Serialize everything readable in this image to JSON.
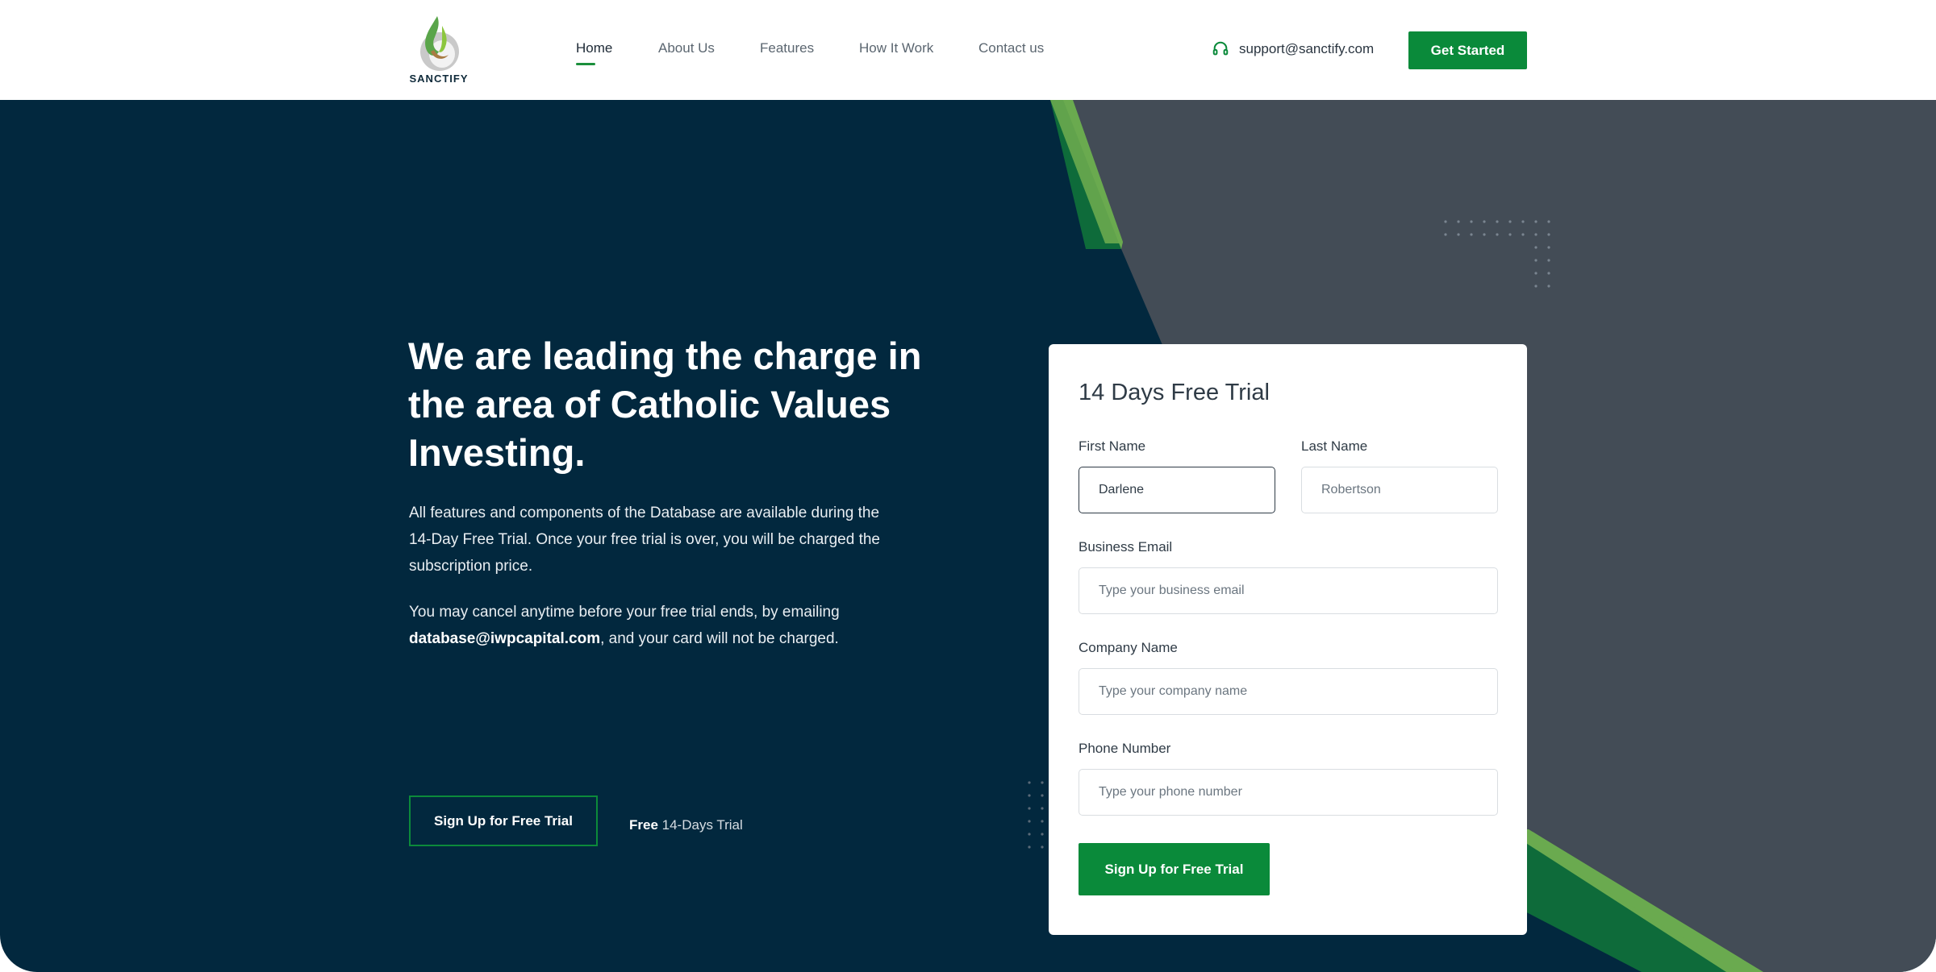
{
  "header": {
    "logo_text": "SANCTIFY",
    "nav": [
      {
        "label": "Home",
        "active": true
      },
      {
        "label": "About Us"
      },
      {
        "label": "Features"
      },
      {
        "label": "How It Work"
      },
      {
        "label": "Contact us"
      }
    ],
    "support_email": "support@sanctify.com",
    "support_icon": "headset-icon",
    "cta_label": "Get Started"
  },
  "hero": {
    "headline": "We are leading the charge in the area of Catholic Values Investing.",
    "paragraph1": "All features and components of the Database are available during the 14-Day Free Trial. Once your free trial is over, you will be charged the subscription price.",
    "paragraph2_prefix": "You may cancel anytime before your free trial ends, by emailing",
    "paragraph2_email": "database@iwpcapital.com",
    "paragraph2_suffix": ", and your card will not be charged.",
    "signup_label": "Sign Up for Free Trial",
    "free_note_bold": "Free",
    "free_note_rest": " 14-Days Trial"
  },
  "form": {
    "title": "14 Days Free Trial",
    "first_name_label": "First Name",
    "first_name_value": "Darlene",
    "last_name_label": "Last Name",
    "last_name_value": "Robertson",
    "email_label": "Business Email",
    "email_placeholder": "Type your business email",
    "company_label": "Company Name",
    "company_placeholder": "Type your company name",
    "phone_label": "Phone Number",
    "phone_placeholder": "Type your phone number",
    "submit_label": "Sign Up for Free Trial"
  },
  "colors": {
    "brand_green": "#0a8a3a",
    "light_green": "#6aaa4f",
    "navy": "#02283e",
    "slate": "#434c56"
  }
}
